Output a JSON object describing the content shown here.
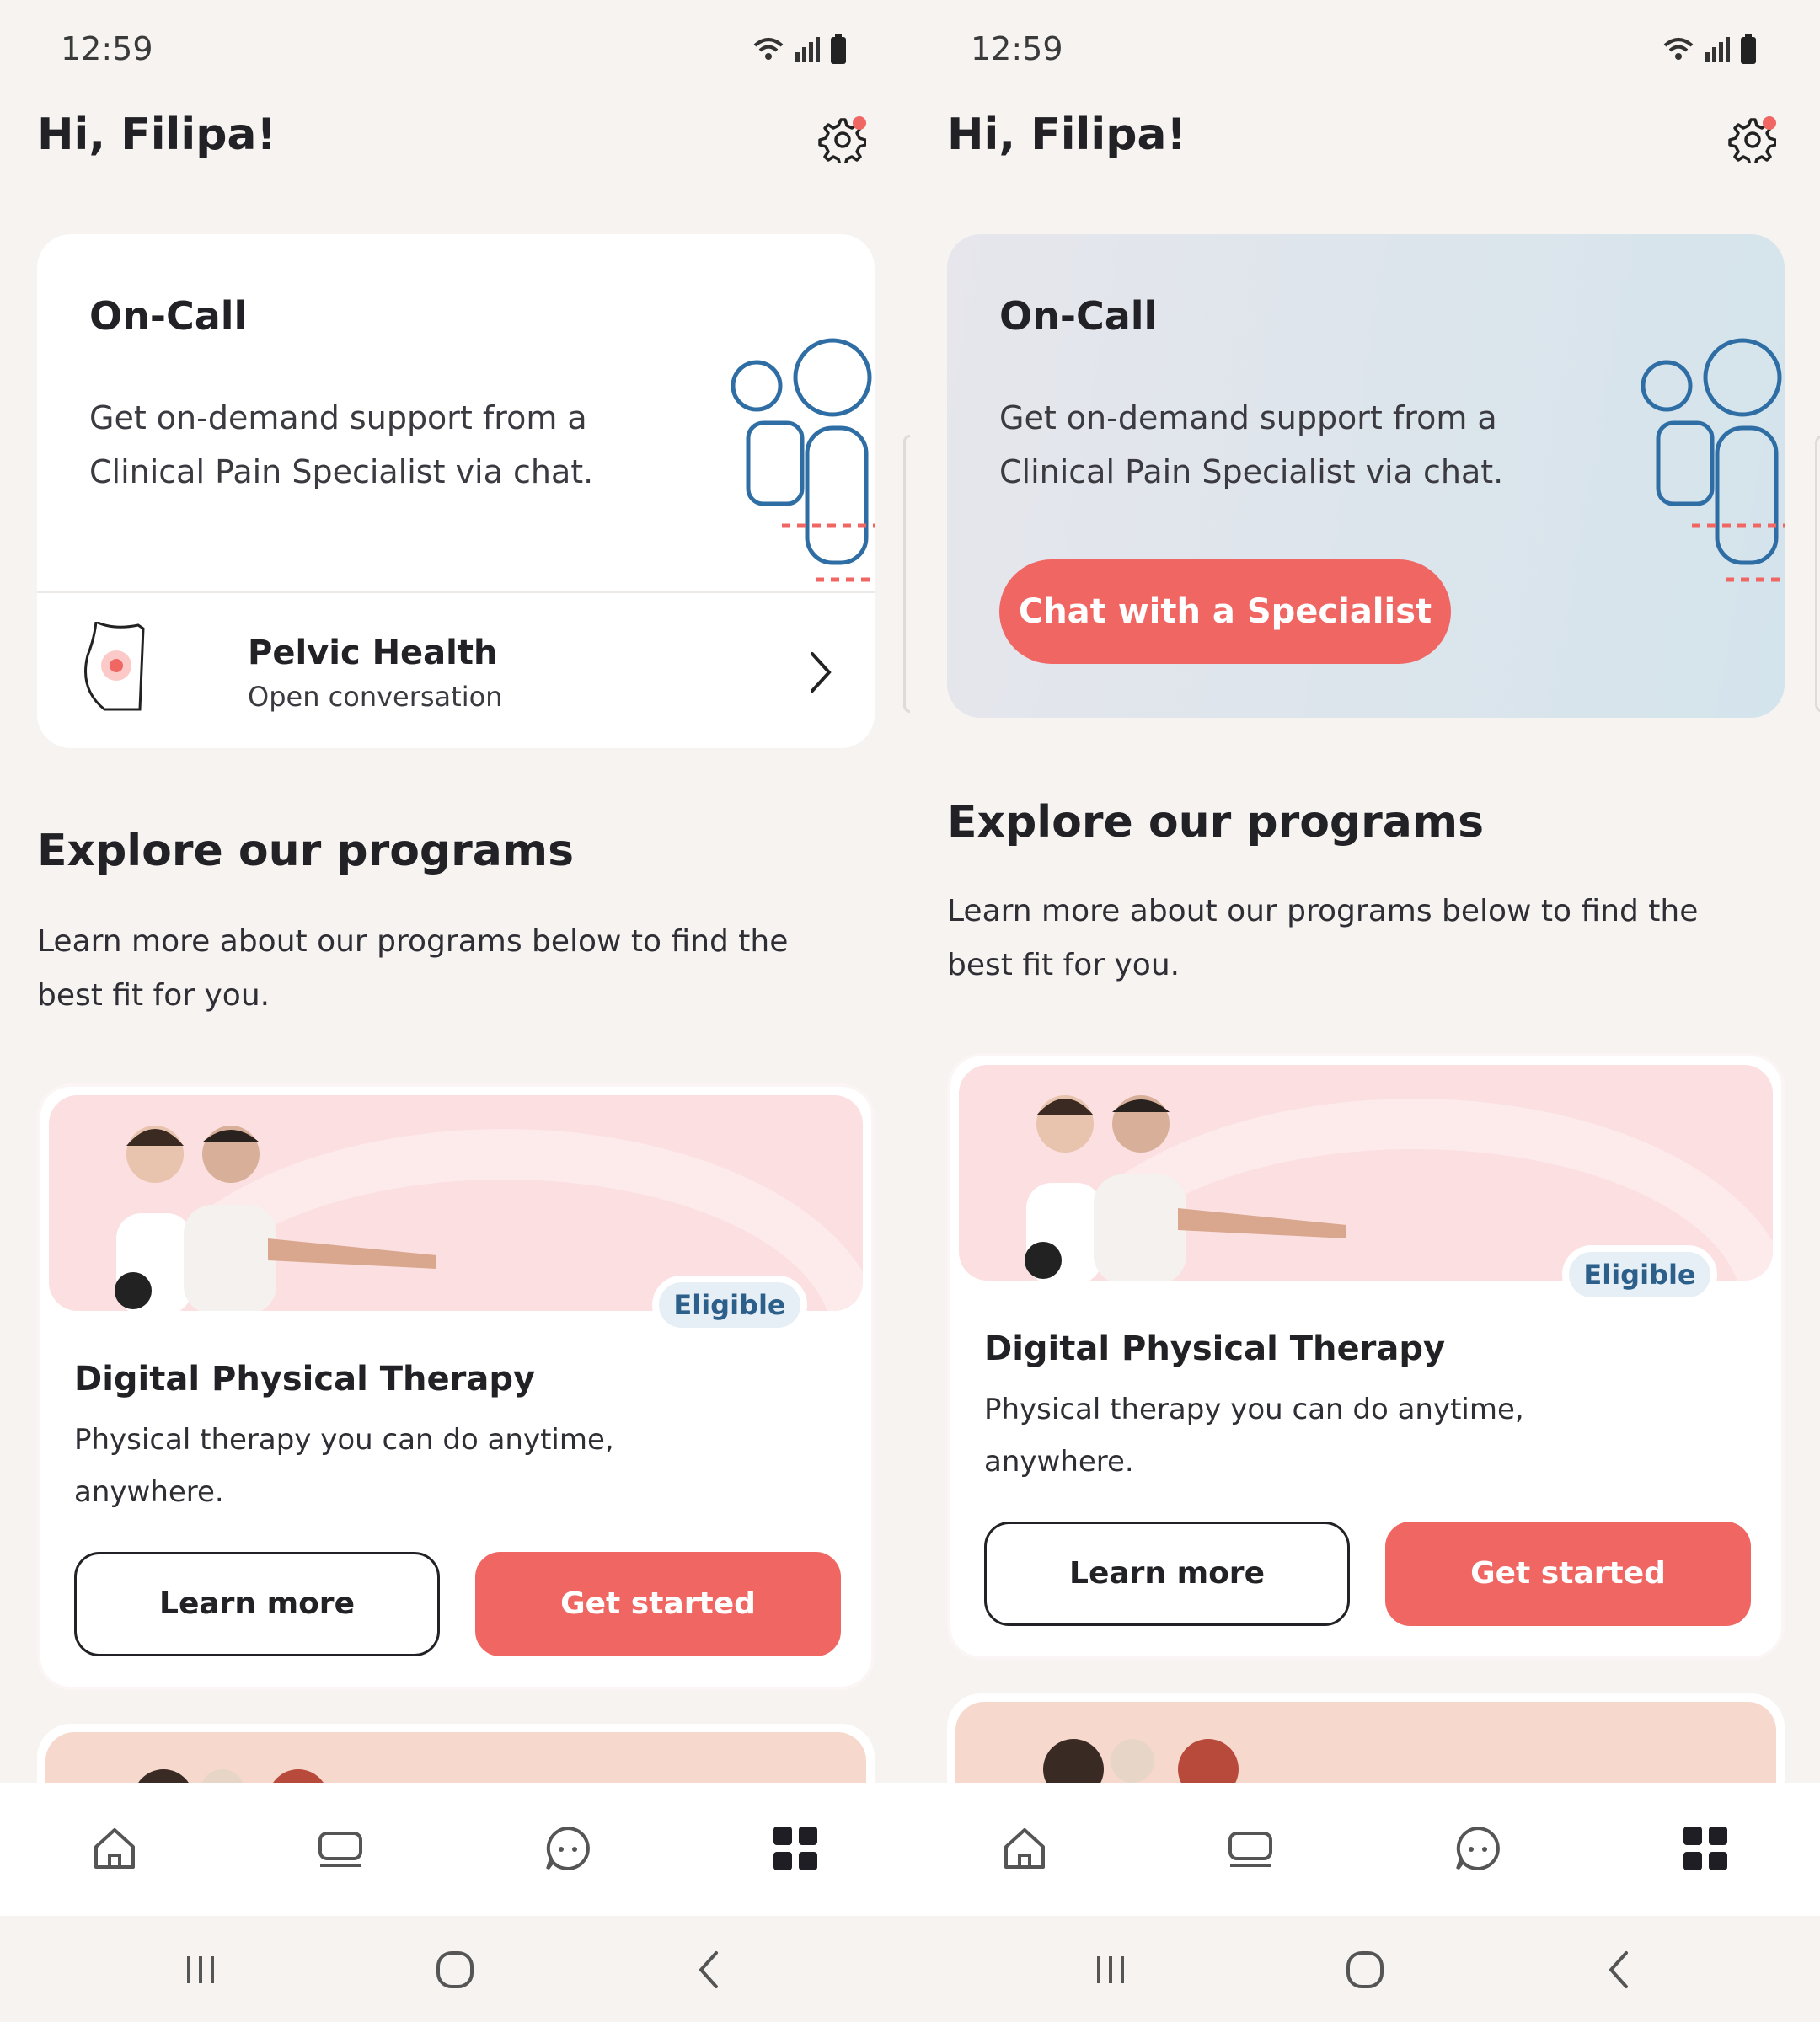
{
  "screens": [
    {
      "status": {
        "time": "12:59"
      },
      "header": {
        "greeting": "Hi, Filipa!"
      },
      "oncall": {
        "title": "On-Call",
        "description": "Get on-demand support from a Clinical Pain Specialist via chat.",
        "item": {
          "name": "Pelvic Health",
          "subtitle": "Open conversation"
        }
      },
      "explore": {
        "title": "Explore our programs",
        "description": "Learn more about our programs below to find the best fit for you."
      },
      "program": {
        "badge": "Eligible",
        "title": "Digital Physical Therapy",
        "description": "Physical therapy you can do anytime, anywhere.",
        "learn_label": "Learn more",
        "start_label": "Get started"
      }
    },
    {
      "status": {
        "time": "12:59"
      },
      "header": {
        "greeting": "Hi, Filipa!"
      },
      "oncall": {
        "title": "On-Call",
        "description": "Get on-demand support from a Clinical Pain Specialist via chat.",
        "button_label": "Chat with a Specialist"
      },
      "explore": {
        "title": "Explore our programs",
        "description": "Learn more about our programs below to find the best fit for you."
      },
      "program": {
        "badge": "Eligible",
        "title": "Digital Physical Therapy",
        "description": "Physical therapy you can do anytime, anywhere.",
        "learn_label": "Learn more",
        "start_label": "Get started"
      }
    }
  ],
  "nav_icons": [
    "home-icon",
    "programs-icon",
    "chat-icon",
    "grid-icon"
  ],
  "system_icons": [
    "recents-icon",
    "home-circle-icon",
    "back-icon"
  ],
  "colors": {
    "accent": "#f06663",
    "background": "#f6f3f1",
    "badge_text": "#2c5f8a",
    "badge_bg": "#e6eff6"
  }
}
